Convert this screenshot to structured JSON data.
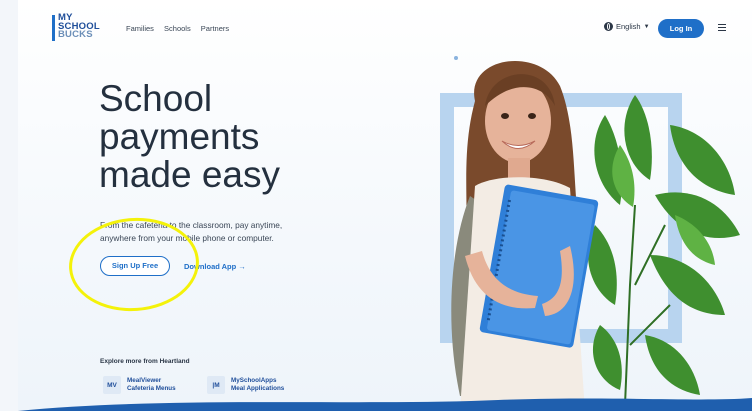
{
  "header": {
    "logo_lines": [
      "MY",
      "SCHOOL",
      "BUCKS"
    ],
    "nav": [
      "Families",
      "Schools",
      "Partners"
    ],
    "language": "English",
    "login_label": "Log In"
  },
  "hero": {
    "headline": [
      "School",
      "payments",
      "made easy"
    ],
    "subtext": "From the cafeteria to the classroom, pay anytime, anywhere from your mobile phone or computer.",
    "signup_label": "Sign Up Free",
    "download_label": "Download App →"
  },
  "explore": {
    "title": "Explore more from Heartland",
    "apps": [
      {
        "badge": "MV",
        "line1": "MealViewer",
        "line2": "Cafeteria Menus"
      },
      {
        "badge": "|M",
        "line1": "MySchoolApps",
        "line2": "Meal Applications"
      }
    ]
  },
  "colors": {
    "brand": "#1f6fc8",
    "highlight": "#f4f20a",
    "frame": "#b8d4ef"
  }
}
